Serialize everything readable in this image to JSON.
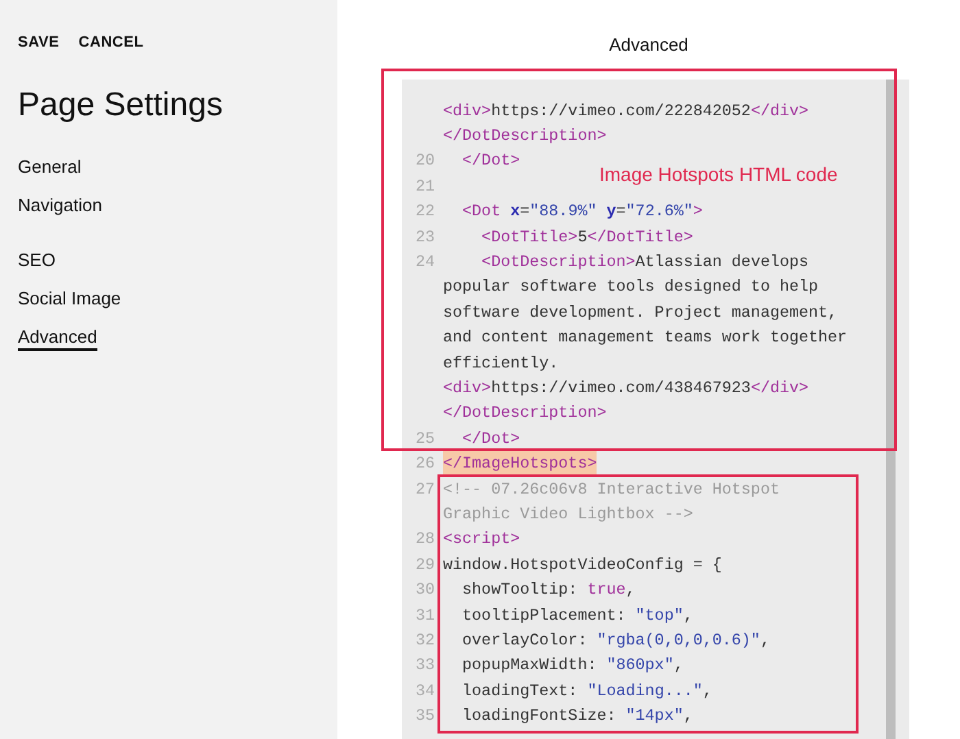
{
  "sidebar": {
    "actions": [
      "SAVE",
      "CANCEL"
    ],
    "title": "Page Settings",
    "groups": [
      [
        {
          "label": "General",
          "selected": false
        },
        {
          "label": "Navigation",
          "selected": false
        }
      ],
      [
        {
          "label": "SEO",
          "selected": false
        },
        {
          "label": "Social Image",
          "selected": false
        },
        {
          "label": "Advanced",
          "selected": true
        }
      ]
    ]
  },
  "panel": {
    "title": "Advanced",
    "code_rows": [
      {
        "segments": [
          {
            "t": "<div>",
            "kind": "tag"
          },
          {
            "t": "https://vimeo.com/222842052",
            "kind": "text"
          },
          {
            "t": "</div>",
            "kind": "tag"
          }
        ]
      },
      {
        "segments": [
          {
            "t": "</DotDescription>",
            "kind": "tag"
          }
        ]
      },
      {
        "num": "20",
        "segments": [
          {
            "t": "  </Dot>",
            "kind": "tag"
          }
        ]
      },
      {
        "num": "21",
        "segments": []
      },
      {
        "num": "22",
        "segments": [
          {
            "t": "  <Dot ",
            "kind": "tag"
          },
          {
            "t": "x",
            "kind": "attr"
          },
          {
            "t": "=",
            "kind": "text"
          },
          {
            "t": "\"88.9%\"",
            "kind": "string"
          },
          {
            "t": " y",
            "kind": "attr"
          },
          {
            "t": "=",
            "kind": "text"
          },
          {
            "t": "\"72.6%\"",
            "kind": "string"
          },
          {
            "t": ">",
            "kind": "tag"
          }
        ]
      },
      {
        "num": "23",
        "segments": [
          {
            "t": "    <DotTitle>",
            "kind": "tag"
          },
          {
            "t": "5",
            "kind": "text"
          },
          {
            "t": "</DotTitle>",
            "kind": "tag"
          }
        ]
      },
      {
        "num": "24",
        "segments": [
          {
            "t": "    <DotDescription>",
            "kind": "tag"
          },
          {
            "t": "Atlassian develops",
            "kind": "text"
          }
        ]
      },
      {
        "segments": [
          {
            "t": "popular software tools designed to help",
            "kind": "text"
          }
        ]
      },
      {
        "segments": [
          {
            "t": "software development. Project management,",
            "kind": "text"
          }
        ]
      },
      {
        "segments": [
          {
            "t": "and content management teams work together",
            "kind": "text"
          }
        ]
      },
      {
        "segments": [
          {
            "t": "efficiently.",
            "kind": "text"
          }
        ]
      },
      {
        "segments": [
          {
            "t": "<div>",
            "kind": "tag"
          },
          {
            "t": "https://vimeo.com/438467923",
            "kind": "text"
          },
          {
            "t": "</div>",
            "kind": "tag"
          }
        ]
      },
      {
        "segments": [
          {
            "t": "</DotDescription>",
            "kind": "tag"
          }
        ]
      },
      {
        "num": "25",
        "segments": [
          {
            "t": "  </Dot>",
            "kind": "tag"
          }
        ]
      },
      {
        "num": "26",
        "highlighted": true,
        "segments": [
          {
            "t": "</ImageHotspots>",
            "kind": "tag"
          }
        ]
      },
      {
        "num": "27",
        "segments": [
          {
            "t": "<!-- 07.26c06v8 Interactive Hotspot",
            "kind": "comment"
          }
        ]
      },
      {
        "segments": [
          {
            "t": "Graphic Video Lightbox -->",
            "kind": "comment"
          }
        ]
      },
      {
        "num": "28",
        "segments": [
          {
            "t": "<script>",
            "kind": "tag"
          }
        ]
      },
      {
        "num": "29",
        "segments": [
          {
            "t": "window.HotspotVideoConfig = {",
            "kind": "text"
          }
        ]
      },
      {
        "num": "30",
        "segments": [
          {
            "t": "  showTooltip: ",
            "kind": "text"
          },
          {
            "t": "true",
            "kind": "keyword"
          },
          {
            "t": ",",
            "kind": "text"
          }
        ]
      },
      {
        "num": "31",
        "segments": [
          {
            "t": "  tooltipPlacement: ",
            "kind": "text"
          },
          {
            "t": "\"top\"",
            "kind": "string"
          },
          {
            "t": ",",
            "kind": "text"
          }
        ]
      },
      {
        "num": "32",
        "segments": [
          {
            "t": "  overlayColor: ",
            "kind": "text"
          },
          {
            "t": "\"rgba(0,0,0,0.6)\"",
            "kind": "string"
          },
          {
            "t": ",",
            "kind": "text"
          }
        ]
      },
      {
        "num": "33",
        "segments": [
          {
            "t": "  popupMaxWidth: ",
            "kind": "text"
          },
          {
            "t": "\"860px\"",
            "kind": "string"
          },
          {
            "t": ",",
            "kind": "text"
          }
        ]
      },
      {
        "num": "34",
        "segments": [
          {
            "t": "  loadingText: ",
            "kind": "text"
          },
          {
            "t": "\"Loading...\"",
            "kind": "string"
          },
          {
            "t": ",",
            "kind": "text"
          }
        ]
      },
      {
        "num": "35",
        "segments": [
          {
            "t": "  loadingFontSize: ",
            "kind": "text"
          },
          {
            "t": "\"14px\"",
            "kind": "string"
          },
          {
            "t": ",",
            "kind": "text"
          }
        ]
      }
    ],
    "annotation": "Image Hotspots HTML code"
  }
}
